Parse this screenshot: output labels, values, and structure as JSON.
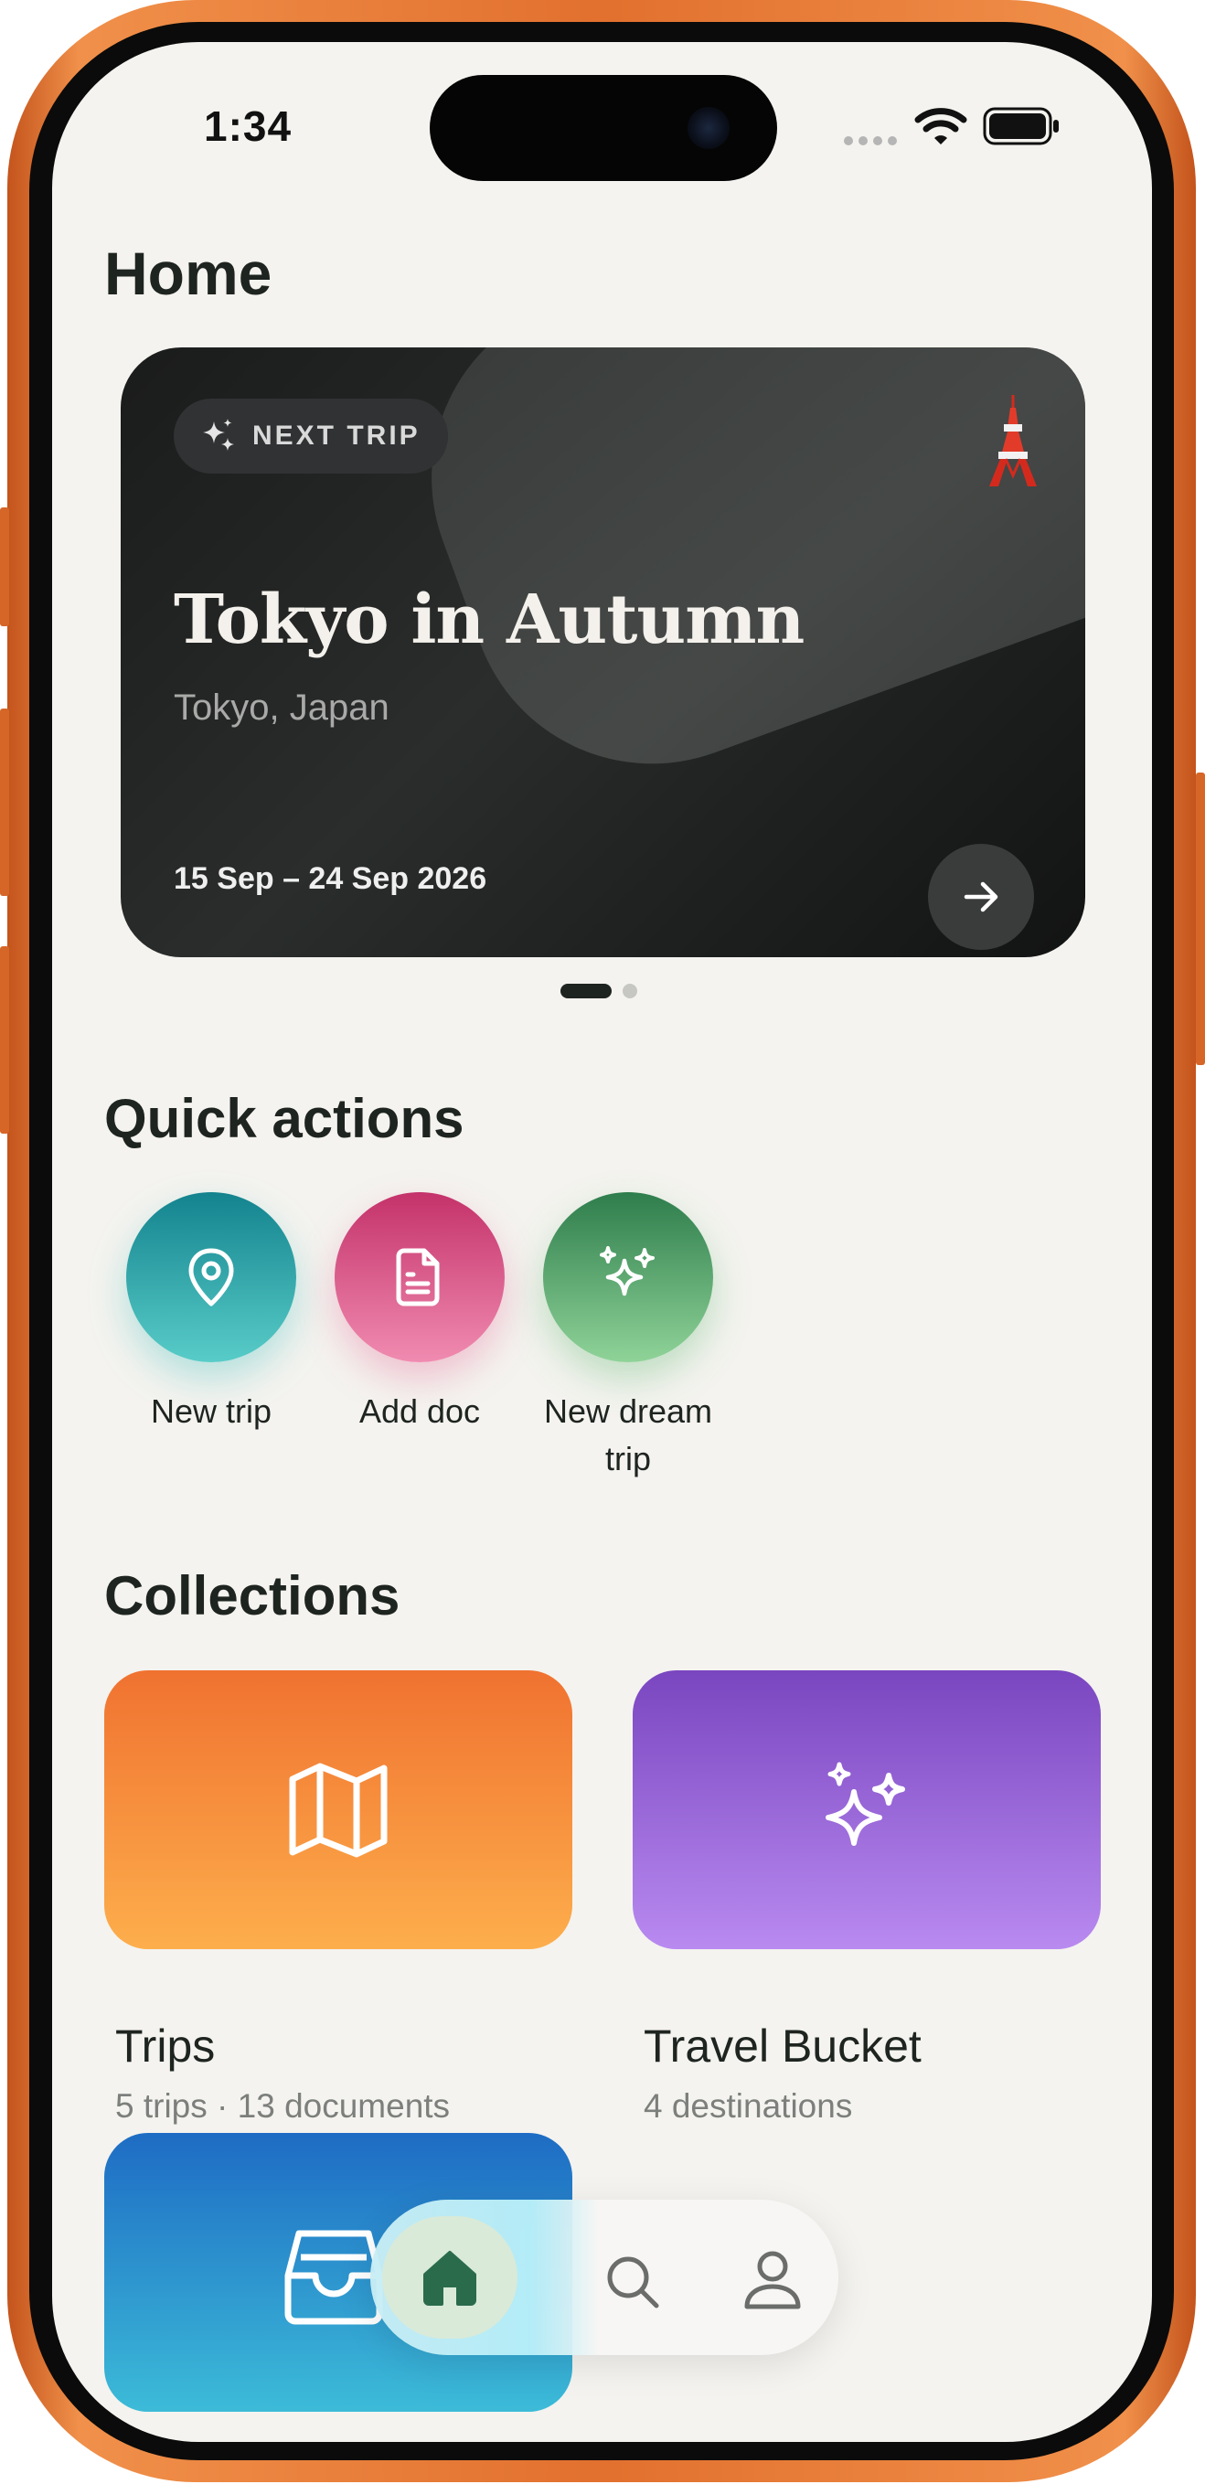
{
  "status_bar": {
    "time": "1:34"
  },
  "page": {
    "title": "Home"
  },
  "hero_card": {
    "badge": "NEXT TRIP",
    "title": "Tokyo in Autumn",
    "location": "Tokyo, Japan",
    "dates": "15 Sep – 24 Sep 2026",
    "icon": "tokyo-tower-icon"
  },
  "carousel": {
    "pages": 2,
    "current": 1
  },
  "quick_actions": {
    "title": "Quick actions",
    "items": [
      {
        "label": "New trip",
        "icon": "map-pin-icon"
      },
      {
        "label": "Add doc",
        "icon": "document-icon"
      },
      {
        "label": "New dream trip",
        "icon": "sparkles-icon"
      }
    ]
  },
  "collections": {
    "title": "Collections",
    "items": [
      {
        "name": "Trips",
        "meta": "5 trips · 13 documents",
        "icon": "map-icon"
      },
      {
        "name": "Travel Bucket",
        "meta": "4 destinations",
        "icon": "sparkles-icon"
      },
      {
        "name": "",
        "meta": "",
        "icon": "inbox-icon"
      }
    ]
  },
  "tab_bar": {
    "items": [
      {
        "name": "home",
        "icon": "home-icon",
        "active": true
      },
      {
        "name": "search",
        "icon": "search-icon",
        "active": false
      },
      {
        "name": "profile",
        "icon": "user-icon",
        "active": false
      }
    ]
  },
  "colors": {
    "background": "#f4f3ef",
    "frame": "#e2702e",
    "accent_green": "#2a6b4c",
    "trips_gradient": [
      "#f07230",
      "#fdae4c"
    ],
    "bucket_gradient": [
      "#7a46c0",
      "#b98af0"
    ],
    "inbox_gradient": [
      "#1e6cc4",
      "#3cbbd8"
    ]
  }
}
